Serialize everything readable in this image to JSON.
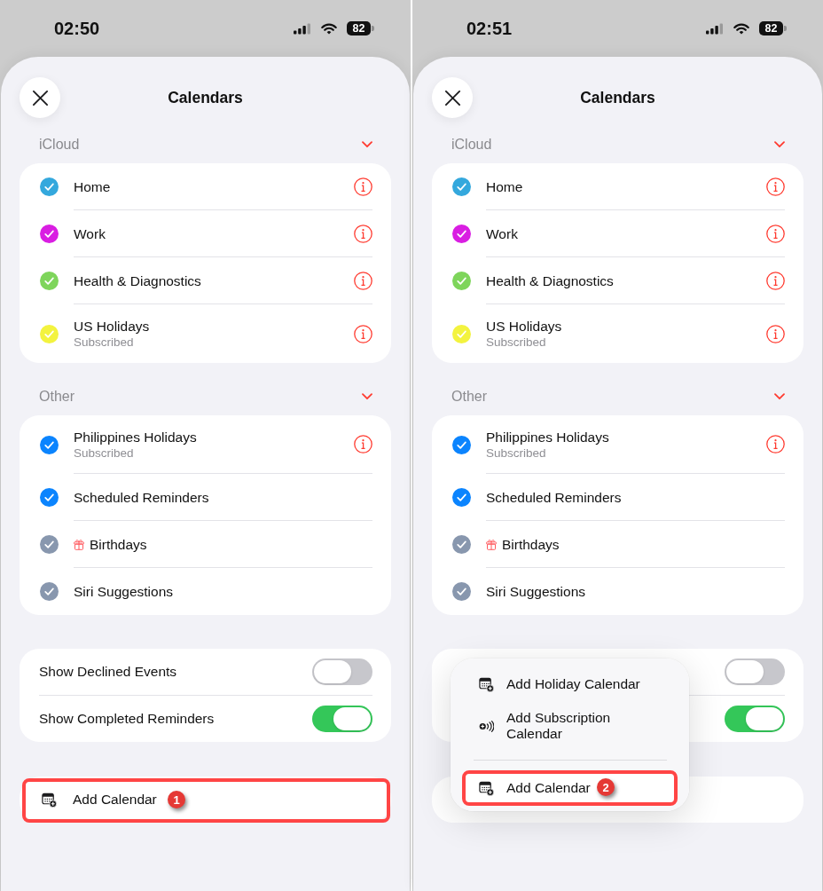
{
  "screens": [
    {
      "status_bar": {
        "time": "02:50",
        "battery": "82"
      },
      "title": "Calendars",
      "sections": [
        {
          "header": "iCloud",
          "expanded": true,
          "calendars": [
            {
              "name": "Home",
              "kind": "calendar",
              "checked": true,
              "color": "#34a8dd",
              "info": true
            },
            {
              "name": "Work",
              "kind": "calendar",
              "checked": true,
              "color": "#d91ee2",
              "info": true
            },
            {
              "name": "Health & Diagnostics",
              "kind": "calendar",
              "checked": true,
              "color": "#7ed55b",
              "info": true
            },
            {
              "name": "US Holidays",
              "subtitle": "Subscribed",
              "kind": "calendar",
              "checked": true,
              "color": "#f3f33f",
              "info": true
            }
          ]
        },
        {
          "header": "Other",
          "expanded": true,
          "calendars": [
            {
              "name": "Philippines Holidays",
              "subtitle": "Subscribed",
              "kind": "calendar",
              "checked": true,
              "color": "#0b84fe",
              "info": true
            },
            {
              "name": "Scheduled Reminders",
              "kind": "calendar",
              "checked": true,
              "color": "#0b84fe",
              "info": false
            },
            {
              "name": "Birthdays",
              "kind": "birthdays",
              "checked": true,
              "color": "#8897ae",
              "info": false
            },
            {
              "name": "Siri Suggestions",
              "kind": "calendar",
              "checked": true,
              "color": "#8897ae",
              "info": false
            }
          ]
        }
      ],
      "toggles": [
        {
          "label": "Show Declined Events",
          "on": false
        },
        {
          "label": "Show Completed Reminders",
          "on": true
        }
      ],
      "add_button": {
        "label": "Add Calendar",
        "highlighted": true,
        "step": "1"
      }
    },
    {
      "status_bar": {
        "time": "02:51",
        "battery": "82"
      },
      "title": "Calendars",
      "sections": [
        {
          "header": "iCloud",
          "expanded": true,
          "calendars": [
            {
              "name": "Home",
              "kind": "calendar",
              "checked": true,
              "color": "#34a8dd",
              "info": true
            },
            {
              "name": "Work",
              "kind": "calendar",
              "checked": true,
              "color": "#d91ee2",
              "info": true
            },
            {
              "name": "Health & Diagnostics",
              "kind": "calendar",
              "checked": true,
              "color": "#7ed55b",
              "info": true
            },
            {
              "name": "US Holidays",
              "subtitle": "Subscribed",
              "kind": "calendar",
              "checked": true,
              "color": "#f3f33f",
              "info": true
            }
          ]
        },
        {
          "header": "Other",
          "expanded": true,
          "calendars": [
            {
              "name": "Philippines Holidays",
              "subtitle": "Subscribed",
              "kind": "calendar",
              "checked": true,
              "color": "#0b84fe",
              "info": true
            },
            {
              "name": "Scheduled Reminders",
              "kind": "calendar",
              "checked": true,
              "color": "#0b84fe",
              "info": false
            },
            {
              "name": "Birthdays",
              "kind": "birthdays",
              "checked": true,
              "color": "#8897ae",
              "info": false
            },
            {
              "name": "Siri Suggestions",
              "kind": "calendar",
              "checked": true,
              "color": "#8897ae",
              "info": false
            }
          ]
        }
      ],
      "toggles": [
        {
          "on": false
        },
        {
          "on": true
        }
      ],
      "add_button": {
        "highlighted": false
      },
      "menu": {
        "sections": [
          {
            "items": [
              {
                "label": "Add Holiday Calendar",
                "kind": "holiday",
                "highlighted": false
              },
              {
                "label": "Add Subscription Calendar",
                "kind": "subscription",
                "highlighted": false
              }
            ]
          },
          {
            "items": [
              {
                "label": "Add Calendar",
                "kind": "calendar",
                "highlighted": true,
                "step": "2"
              }
            ]
          }
        ]
      }
    }
  ]
}
